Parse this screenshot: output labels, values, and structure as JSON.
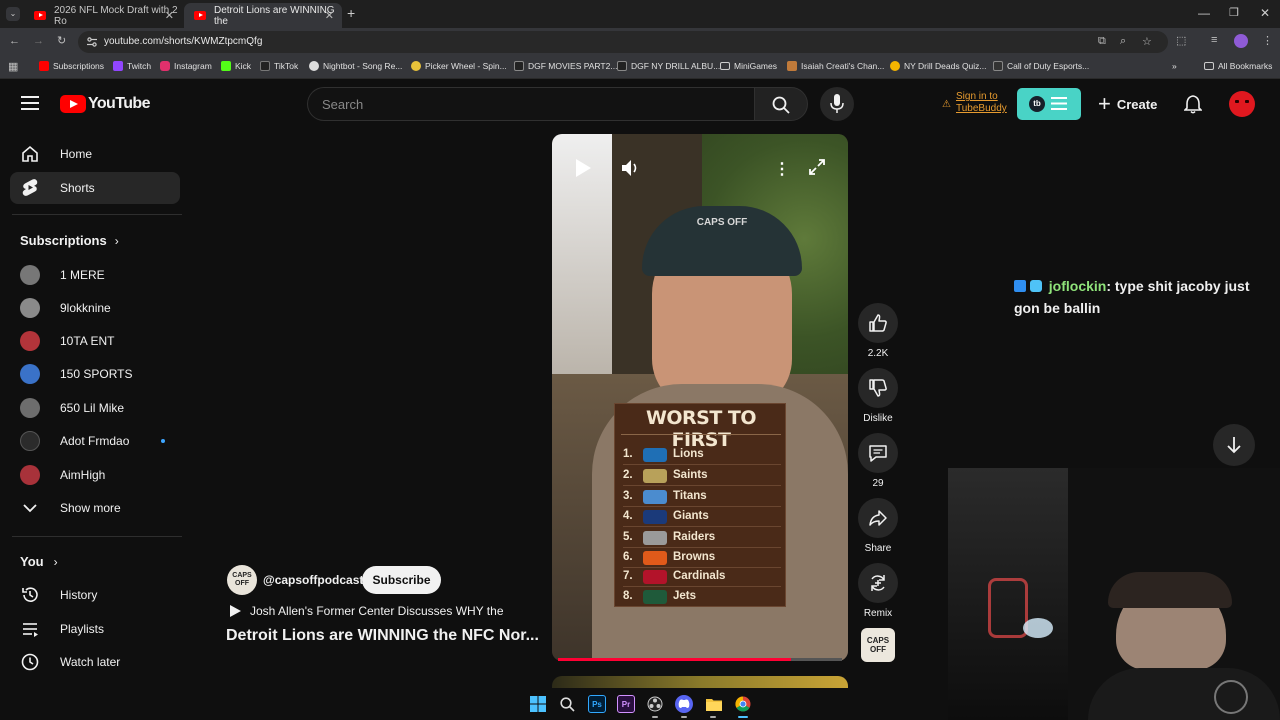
{
  "browser": {
    "tabs": [
      {
        "title": "2026 NFL Mock Draft with 2 Ro",
        "active": false
      },
      {
        "title": "Detroit Lions are WINNING the",
        "active": true
      }
    ],
    "url": "youtube.com/shorts/KWMZtpcmQfg",
    "bookmarks": [
      {
        "label": "Subscriptions",
        "color": "#ff0000"
      },
      {
        "label": "Twitch",
        "color": "#9146ff"
      },
      {
        "label": "Instagram",
        "color": "#e1306c"
      },
      {
        "label": "Kick",
        "color": "#53fc18"
      },
      {
        "label": "TikTok",
        "color": "#222222"
      },
      {
        "label": "Nightbot - Song Re...",
        "color": "#dddddd"
      },
      {
        "label": "Picker Wheel - Spin...",
        "color": "#e8c23a"
      },
      {
        "label": "DGF MOVIES PART2...",
        "color": "#222222"
      },
      {
        "label": "DGF NY DRILL ALBU...",
        "color": "#222222"
      },
      {
        "label": "MiniGames",
        "color": "folder"
      },
      {
        "label": "Isaiah Creati's Chan...",
        "color": "#c07a3a"
      },
      {
        "label": "NY Drill Deads Quiz...",
        "color": "#f4b400"
      },
      {
        "label": "Call of Duty Esports...",
        "color": "#333333"
      }
    ],
    "all_bookmarks": "All Bookmarks"
  },
  "header": {
    "logo": "YouTube",
    "search_placeholder": "Search",
    "sign_in": "Sign in to TubeBuddy",
    "create": "Create",
    "brand_color": "#ff0000",
    "tubebuddy_color": "#49d3c6"
  },
  "sidebar": {
    "main": [
      {
        "label": "Home",
        "icon": "home-icon"
      },
      {
        "label": "Shorts",
        "icon": "shorts-icon",
        "active": true
      }
    ],
    "subscriptions_title": "Subscriptions",
    "subscriptions": [
      {
        "label": "1 MERE",
        "color": "#777777"
      },
      {
        "label": "9lokknine",
        "color": "#8a8a8a"
      },
      {
        "label": "10TA ENT",
        "color": "#b3343a"
      },
      {
        "label": "150 SPORTS",
        "color": "#3a72c8"
      },
      {
        "label": "650 Lil Mike",
        "color": "#6d6d6d"
      },
      {
        "label": "Adot Frmdao",
        "color": "#2b2b2b",
        "dot": true
      },
      {
        "label": "AimHigh",
        "color": "#a8323a"
      }
    ],
    "show_more": "Show more",
    "you_title": "You",
    "you": [
      {
        "label": "History",
        "icon": "history-icon"
      },
      {
        "label": "Playlists",
        "icon": "playlists-icon"
      },
      {
        "label": "Watch later",
        "icon": "watch-later-icon"
      }
    ]
  },
  "short": {
    "channel": "@capsoffpodcast",
    "subscribe": "Subscribe",
    "subtitle": "Josh Allen's Former Center Discusses WHY the",
    "title": "Detroit Lions are WINNING the NFC Nor...",
    "progress": 0.82,
    "graphic_title": "WORST TO FIRST",
    "ranking": [
      {
        "num": "1.",
        "team": "Lions",
        "color": "#1f6fb5"
      },
      {
        "num": "2.",
        "team": "Saints",
        "color": "#b8a15a"
      },
      {
        "num": "3.",
        "team": "Titans",
        "color": "#4b8ccf"
      },
      {
        "num": "4.",
        "team": "Giants",
        "color": "#1b3a7a"
      },
      {
        "num": "5.",
        "team": "Raiders",
        "color": "#9a9a9a"
      },
      {
        "num": "6.",
        "team": "Browns",
        "color": "#e05a1a"
      },
      {
        "num": "7.",
        "team": "Cardinals",
        "color": "#b3132a"
      },
      {
        "num": "8.",
        "team": "Jets",
        "color": "#1f5a3a"
      }
    ],
    "cap_text": "CAPS OFF",
    "actions": [
      {
        "label": "2.2K",
        "icon": "like-icon"
      },
      {
        "label": "Dislike",
        "icon": "dislike-icon"
      },
      {
        "label": "29",
        "icon": "comments-icon"
      },
      {
        "label": "Share",
        "icon": "share-icon"
      },
      {
        "label": "Remix",
        "icon": "remix-icon"
      }
    ],
    "caps_badge": "CAPS OFF"
  },
  "chat": {
    "user": "joflockin",
    "message": ": type shit jacoby just gon be ballin",
    "user_color": "#8fe37a"
  }
}
